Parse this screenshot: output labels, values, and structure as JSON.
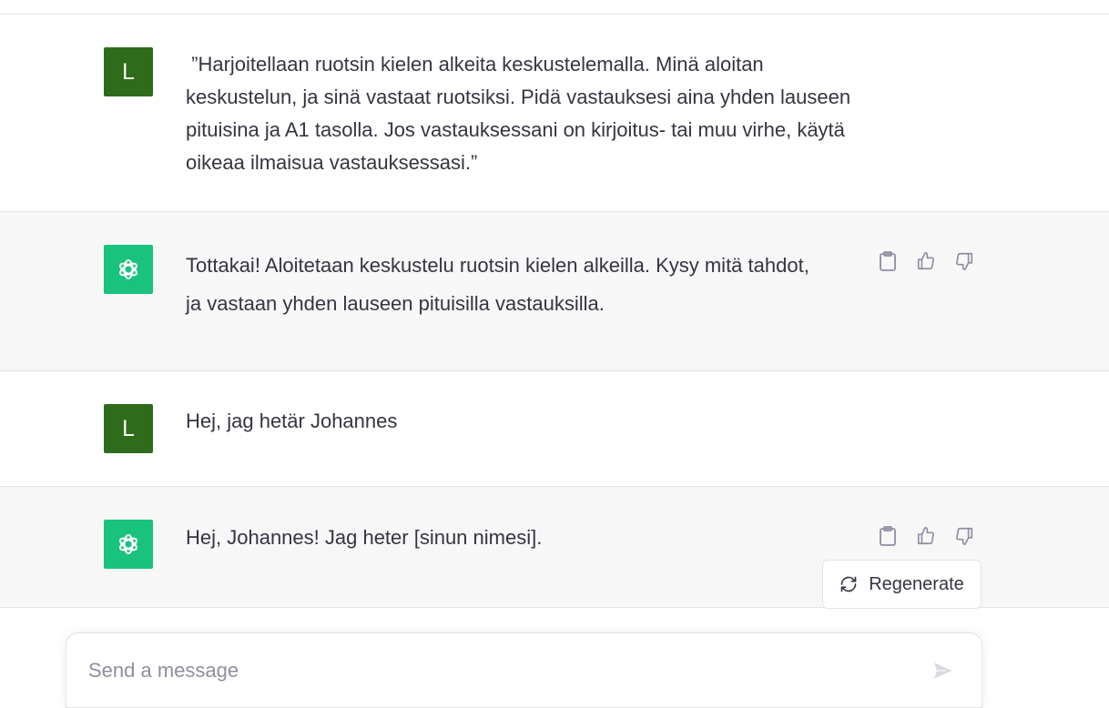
{
  "conversation": {
    "messages": [
      {
        "role": "user",
        "avatar_letter": "L",
        "text": " ”Harjoitellaan ruotsin kielen alkeita keskustelemalla. Minä aloitan keskustelun, ja sinä vastaat ruotsiksi. Pidä vastauksesi aina yhden lauseen pituisina ja A1 tasolla. Jos vastauksessani on kirjoitus- tai muu virhe, käytä oikeaa ilmaisua vastauksessasi.”"
      },
      {
        "role": "assistant",
        "text": "Tottakai! Aloitetaan keskustelu ruotsin kielen alkeilla. Kysy mitä tahdot, ja vastaan yhden lauseen pituisilla vastauksilla."
      },
      {
        "role": "user",
        "avatar_letter": "L",
        "text": "Hej, jag hetär Johannes"
      },
      {
        "role": "assistant",
        "text": "Hej, Johannes! Jag heter [sinun nimesi]."
      }
    ]
  },
  "actions": {
    "regenerate_label": "Regenerate"
  },
  "composer": {
    "placeholder": "Send a message",
    "value": ""
  },
  "colors": {
    "user_avatar": "#2e6b1b",
    "assistant_avatar": "#19c37d",
    "assistant_row_bg": "#f7f7f8"
  },
  "icons": [
    "openai-logo-icon",
    "clipboard-icon",
    "thumbs-up-icon",
    "thumbs-down-icon",
    "refresh-icon",
    "send-icon"
  ]
}
